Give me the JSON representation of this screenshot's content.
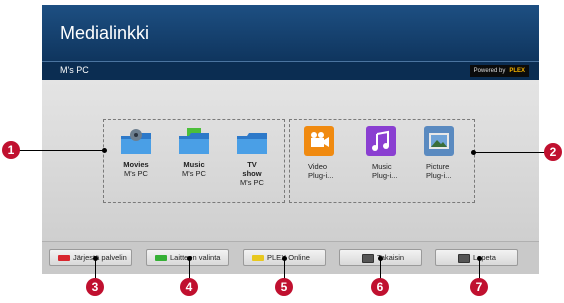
{
  "header": {
    "title": "Medialinkki"
  },
  "subbar": {
    "source": "M's PC",
    "powered_by": "Powered by",
    "powered_brand": "PLEX"
  },
  "media_items": [
    {
      "title": "Movies",
      "subtitle": "M's PC",
      "icon": "movies-folder-icon"
    },
    {
      "title": "Music",
      "subtitle": "M's PC",
      "icon": "music-folder-icon"
    },
    {
      "title": "TV",
      "title2": "show",
      "subtitle": "M's PC",
      "icon": "tv-show-folder-icon"
    }
  ],
  "plugins": [
    {
      "line1": "Video",
      "line2": "Plug-i...",
      "icon": "video-plugin-icon",
      "color": "#f08a10"
    },
    {
      "line1": "Music",
      "line2": "Plug-i...",
      "icon": "music-plugin-icon",
      "color": "#8a3fd1"
    },
    {
      "line1": "Picture",
      "line2": "Plug-i...",
      "icon": "picture-plugin-icon",
      "color": "#5a8ac0"
    }
  ],
  "buttons": [
    {
      "label": "Järjestä palvelin",
      "chip_color": "#d8262e"
    },
    {
      "label": "Laitteen valinta",
      "chip_color": "#35b035"
    },
    {
      "label": "PLEX Online",
      "chip_color": "#e8c81e"
    },
    {
      "label": "Takaisin",
      "icon": "back-key-icon"
    },
    {
      "label": "Lopeta",
      "icon": "exit-key-icon"
    }
  ],
  "callouts": [
    "1",
    "2",
    "3",
    "4",
    "5",
    "6",
    "7"
  ],
  "colors": {
    "header": "#1d4f82",
    "callout": "#c0102f"
  }
}
